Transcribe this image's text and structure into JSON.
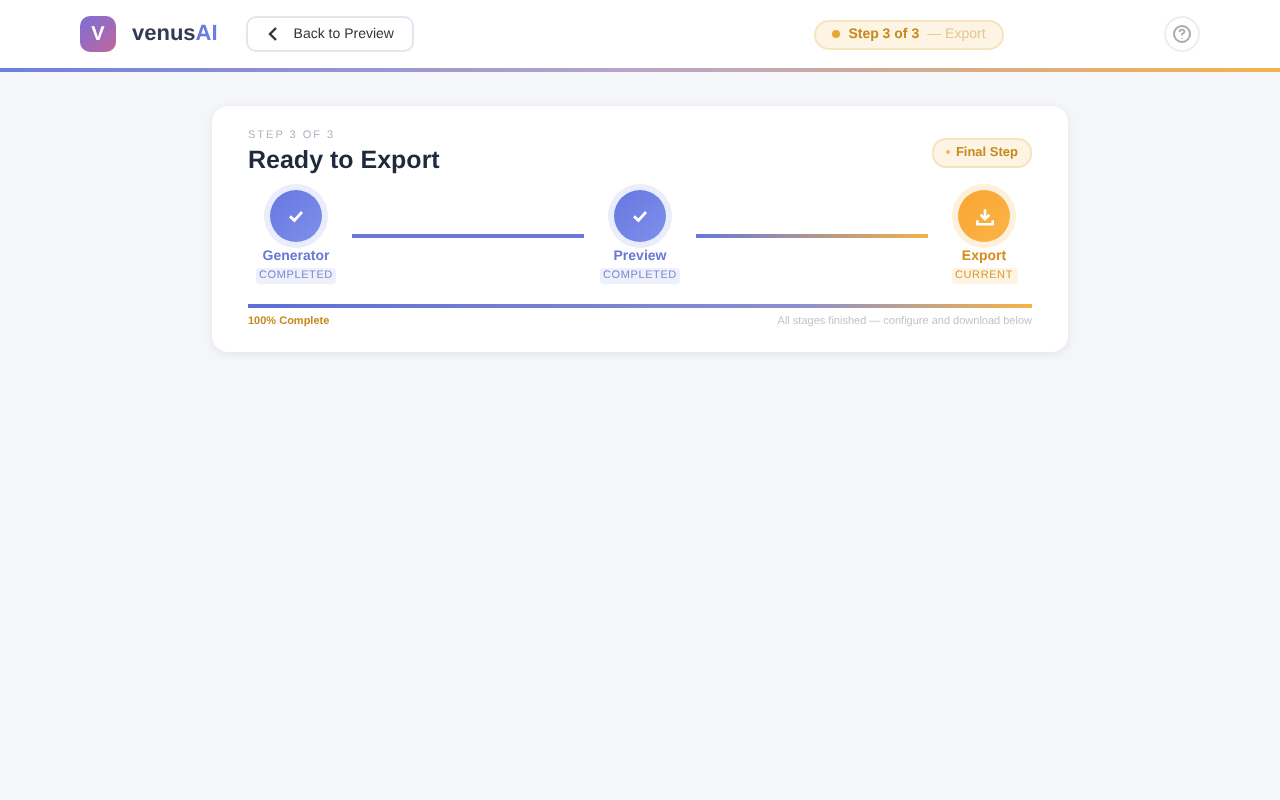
{
  "header": {
    "logo_letter": "V",
    "brand": "venus",
    "brand_accent": "AI",
    "back_button": "Back to Preview",
    "step_pill": {
      "label": "Step 3 of 3",
      "sub": "— Export"
    }
  },
  "card": {
    "eyebrow": "STEP 3 OF 3",
    "title": "Ready to Export",
    "badge": "Final Step",
    "steps": [
      {
        "name": "Generator",
        "status": "COMPLETED",
        "kind": "completed"
      },
      {
        "name": "Preview",
        "status": "COMPLETED",
        "kind": "completed"
      },
      {
        "name": "Export",
        "status": "CURRENT",
        "kind": "current"
      }
    ],
    "progress": {
      "level": 1,
      "label": "100% Complete",
      "note": "All stages finished — configure and download below"
    }
  }
}
